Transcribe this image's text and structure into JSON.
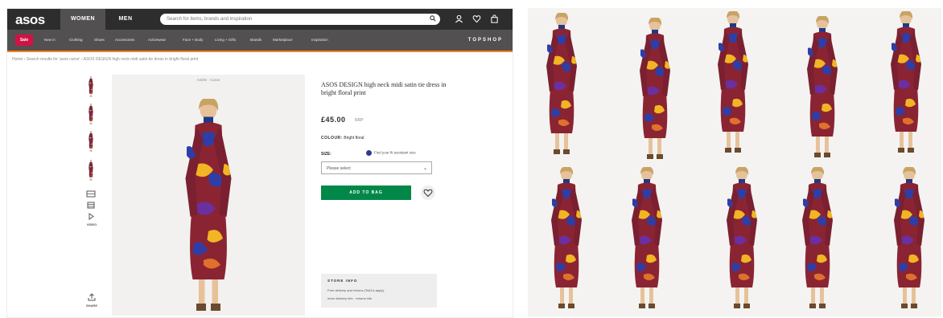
{
  "header": {
    "logo": "asos",
    "women": "WOMEN",
    "men": "MEN",
    "search_placeholder": "Search for items, brands and inspiration",
    "icons": [
      "search-icon",
      "account-icon",
      "saved-items-icon",
      "bag-icon"
    ]
  },
  "nav": {
    "sale": "Sale",
    "items": [
      "New in",
      "Clothing",
      "Shoes",
      "Accessories",
      "Activewear",
      "Face + Body",
      "Living + Gifts",
      "Brands",
      "Marketplace",
      "Inspiration"
    ],
    "topshop": "TOPSHOP"
  },
  "breadcrumb": "Home  ›  Search results for 'asos curve'  ›  ASOS DESIGN high neck midi satin tie dress in bright floral print",
  "image_top": "ASOS  ·  Curve",
  "product": {
    "title": "ASOS DESIGN high neck midi satin tie dress in bright floral print",
    "price": "£45.00",
    "rrp": "RRP",
    "colour_label": "COLOUR:",
    "colour_value": "Bright floral",
    "size_label": "SIZE:",
    "fit_text": "Find your fit assistant size",
    "size_select": "Please select",
    "add_button": "ADD TO BAG",
    "store_title": "STORE INFO",
    "store_line1": "Free delivery and returns (Ts&Cs apply)",
    "store_line2": "more delivery info · returns info"
  },
  "side": {
    "video_label": "VIDEO",
    "share_label": "SHARE"
  },
  "colors": {
    "header": "#2d2d2d",
    "nav": "#525050",
    "sale": "#d01345",
    "accent": "#f58220",
    "add_button": "#018849",
    "dress_base": "#8a2433"
  }
}
